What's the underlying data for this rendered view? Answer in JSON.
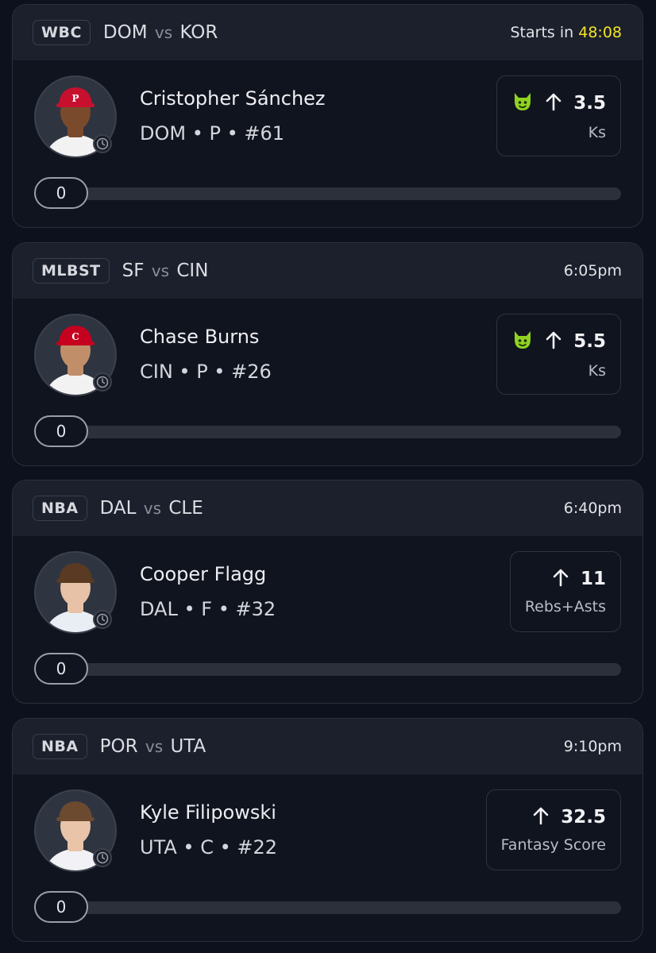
{
  "colors": {
    "background": "#0d111d",
    "card": "#10141f",
    "card_header": "#1b202c",
    "countdown": "#f3e226",
    "demon_icon": "#8fd321"
  },
  "cards": [
    {
      "league": "WBC",
      "home": "DOM",
      "vs": "vs",
      "away": "KOR",
      "time_prefix": "Starts in",
      "time": "48:08",
      "player": {
        "name": "Cristopher Sánchez",
        "meta": "DOM • P • #61",
        "cap_color": "#c8102e",
        "skin": "#7a4a2c",
        "jersey": "#f2f2f2",
        "cap_letter": "P"
      },
      "prop": {
        "icon": "demon-icon",
        "direction_icon": "arrow-up-icon",
        "line": "3.5",
        "stat": "Ks"
      },
      "progress": {
        "value": "0",
        "fraction": 0
      }
    },
    {
      "league": "MLBST",
      "home": "SF",
      "vs": "vs",
      "away": "CIN",
      "time_prefix": "",
      "time": "6:05pm",
      "player": {
        "name": "Chase Burns",
        "meta": "CIN • P • #26",
        "cap_color": "#c6011f",
        "skin": "#c08f6a",
        "jersey": "#f2f2f2",
        "cap_letter": "C"
      },
      "prop": {
        "icon": "demon-icon",
        "direction_icon": "arrow-up-icon",
        "line": "5.5",
        "stat": "Ks"
      },
      "progress": {
        "value": "0",
        "fraction": 0
      }
    },
    {
      "league": "NBA",
      "home": "DAL",
      "vs": "vs",
      "away": "CLE",
      "time_prefix": "",
      "time": "6:40pm",
      "player": {
        "name": "Cooper Flagg",
        "meta": "DAL • F • #32",
        "cap_color": "#5a3a22",
        "skin": "#e8c2a6",
        "jersey": "#e9eef5",
        "cap_letter": ""
      },
      "prop": {
        "icon": "",
        "direction_icon": "arrow-up-icon",
        "line": "11",
        "stat": "Rebs+Asts"
      },
      "progress": {
        "value": "0",
        "fraction": 0
      }
    },
    {
      "league": "NBA",
      "home": "POR",
      "vs": "vs",
      "away": "UTA",
      "time_prefix": "",
      "time": "9:10pm",
      "player": {
        "name": "Kyle Filipowski",
        "meta": "UTA • C • #22",
        "cap_color": "#6b4a30",
        "skin": "#e9c4a8",
        "jersey": "#f1f1f6",
        "cap_letter": ""
      },
      "prop": {
        "icon": "",
        "direction_icon": "arrow-up-icon",
        "line": "32.5",
        "stat": "Fantasy Score"
      },
      "progress": {
        "value": "0",
        "fraction": 0
      }
    }
  ]
}
